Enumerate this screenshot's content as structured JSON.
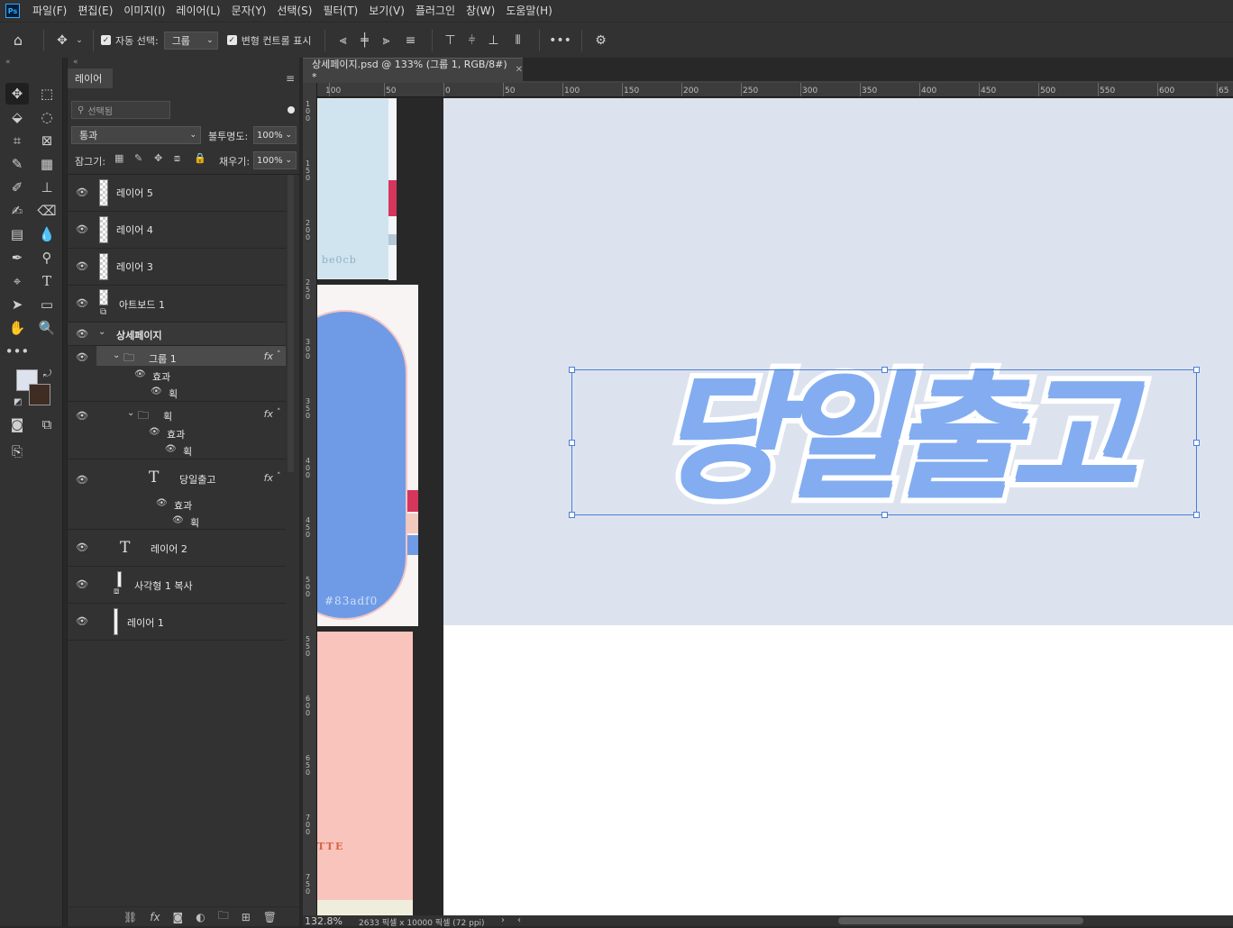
{
  "menubar": {
    "logo": "Ps",
    "items": [
      "파일(F)",
      "편집(E)",
      "이미지(I)",
      "레이어(L)",
      "문자(Y)",
      "선택(S)",
      "필터(T)",
      "보기(V)",
      "플러그인",
      "창(W)",
      "도움말(H)"
    ]
  },
  "options": {
    "auto_select_label": "자동 선택:",
    "auto_select_value": "그룹",
    "transform_controls_label": "변형 컨트롤 표시"
  },
  "layers_panel": {
    "tab": "레이어",
    "search_placeholder": "선택됨",
    "blend_mode": "통과",
    "opacity_label": "불투명도:",
    "opacity_value": "100%",
    "lock_label": "잠그기:",
    "fill_label": "채우기:",
    "fill_value": "100%",
    "layers": [
      {
        "name": "레이어 5"
      },
      {
        "name": "레이어 4"
      },
      {
        "name": "레이어 3"
      },
      {
        "name": "아트보드 1"
      },
      {
        "name": "상세페이지"
      },
      {
        "name": "그룹 1",
        "effects": "효과",
        "effect_item": "획"
      },
      {
        "name": "획",
        "effects": "효과",
        "effect_item": "획"
      },
      {
        "name": "당일출고",
        "effects": "효과",
        "effect_item": "획"
      },
      {
        "name": "레이어 2"
      },
      {
        "name": "사각형 1 복사"
      },
      {
        "name": "레이어 1"
      }
    ]
  },
  "document": {
    "tab_title": "상세페이지.psd @ 133% (그룹 1, RGB/8#) *",
    "ruler_top": [
      "100",
      "50",
      "0",
      "50",
      "100",
      "150",
      "200",
      "250",
      "300",
      "350",
      "400",
      "450",
      "500",
      "550",
      "600",
      "65"
    ],
    "ruler_left": [
      "100",
      "150",
      "200",
      "250",
      "300",
      "350",
      "400",
      "450",
      "500",
      "550",
      "600",
      "650",
      "700",
      "750"
    ],
    "swatch_upper_label": "be0cb",
    "swatch_blue_label": "#83adf0",
    "swatch_pink_label": "TTE",
    "headline": "당일출고"
  },
  "status": {
    "zoom": "132.8%",
    "doc_info": "2633 픽셀 x 10000 픽셀 (72 ppi)"
  },
  "colors": {
    "accent_blue": "#83adf0",
    "canvas_bg": "#dde3ee",
    "pink": "#f8c4bb"
  }
}
